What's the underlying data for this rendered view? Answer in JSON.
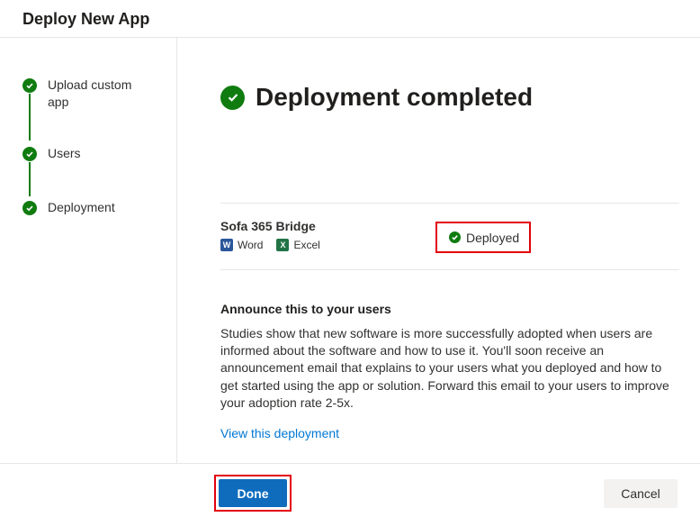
{
  "header": {
    "title": "Deploy New App"
  },
  "steps": [
    {
      "label": "Upload custom app",
      "status": "complete"
    },
    {
      "label": "Users",
      "status": "complete"
    },
    {
      "label": "Deployment",
      "status": "complete"
    }
  ],
  "main": {
    "title": "Deployment completed",
    "app": {
      "name": "Sofa 365 Bridge",
      "hosts": [
        {
          "label": "Word",
          "icon": "word-icon"
        },
        {
          "label": "Excel",
          "icon": "excel-icon"
        }
      ],
      "status": "Deployed"
    },
    "announce": {
      "title": "Announce this to your users",
      "body": "Studies show that new software is more successfully adopted when users are informed about the software and how to use it. You'll soon receive an announcement email that explains to your users what you deployed and how to get started using the app or solution. Forward this email to your users to improve your adoption rate 2-5x."
    },
    "view_link": "View this deployment"
  },
  "footer": {
    "done_label": "Done",
    "cancel_label": "Cancel"
  },
  "colors": {
    "success": "#107c10",
    "primary": "#0f6cbd",
    "link": "#0078d4",
    "highlight": "#e3000f"
  }
}
